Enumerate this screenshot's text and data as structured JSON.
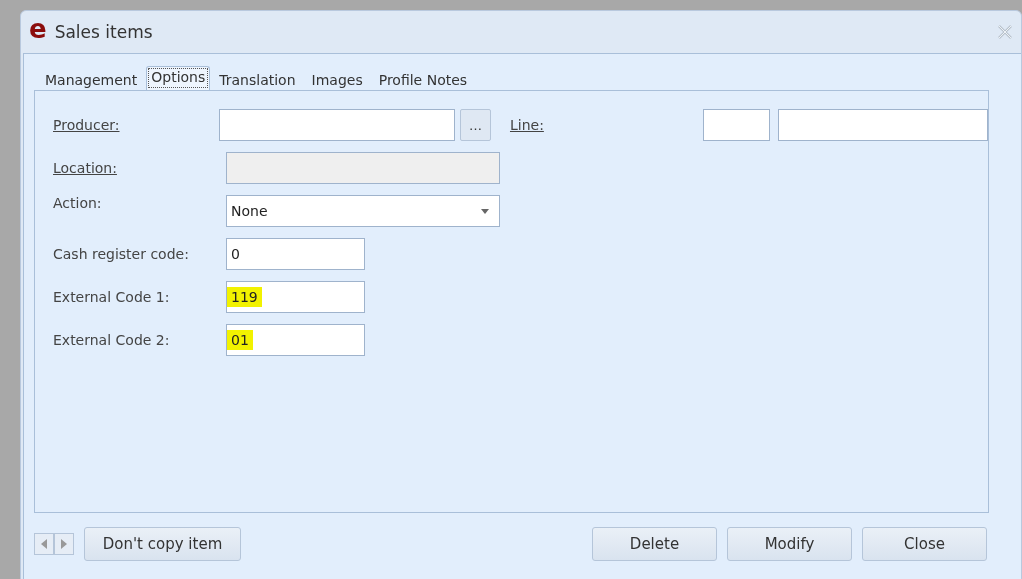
{
  "window": {
    "logo": "e",
    "title": "Sales items"
  },
  "tabs": [
    {
      "label": "Management",
      "selected": false
    },
    {
      "label": "Options",
      "selected": true
    },
    {
      "label": "Translation",
      "selected": false
    },
    {
      "label": "Images",
      "selected": false
    },
    {
      "label": "Profile Notes",
      "selected": false
    }
  ],
  "fields": [
    {
      "label": "Producer:",
      "link": true,
      "kind": "lookup",
      "button": "…",
      "disabled": false
    },
    {
      "label": "Location:",
      "link": true,
      "kind": "wide",
      "disabled": true
    },
    {
      "label": "Action:",
      "link": false,
      "kind": "select",
      "value": "None",
      "disabled": false,
      "highlighted": false
    },
    {
      "label": "Cash register code:",
      "link": false,
      "kind": "short",
      "value": "0",
      "disabled": false,
      "highlighted": false
    },
    {
      "label": "External Code 1:",
      "link": false,
      "kind": "short",
      "value": "119",
      "disabled": false,
      "highlighted": true
    },
    {
      "label": "External Code 2:",
      "link": false,
      "kind": "short",
      "value": "01",
      "disabled": false,
      "highlighted": true
    }
  ],
  "line": {
    "label": "Line:",
    "link": true
  },
  "footer": {
    "left_button": "Don't copy item",
    "buttons": [
      "Delete",
      "Modify",
      "Close"
    ]
  }
}
